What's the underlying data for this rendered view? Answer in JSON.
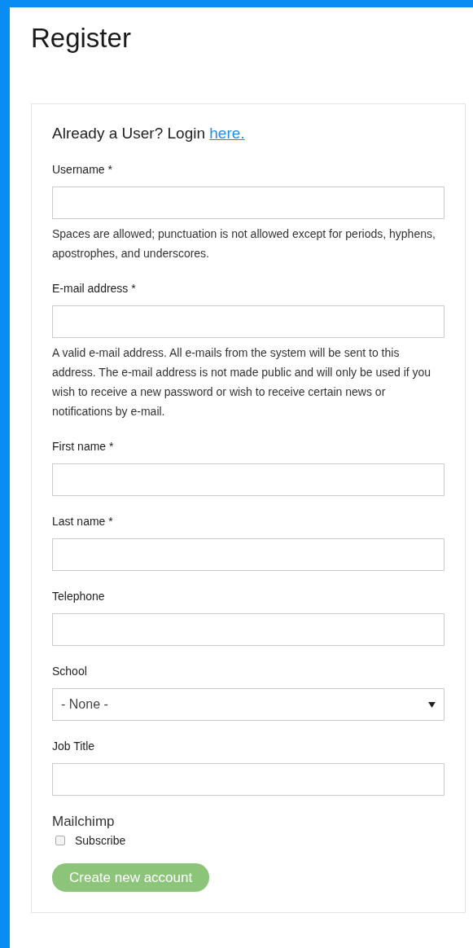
{
  "page": {
    "title": "Register"
  },
  "login_prompt": {
    "text": "Already a User? Login",
    "link": "here."
  },
  "fields": [
    {
      "kind": "text",
      "label": "Username *",
      "help": "Spaces are allowed; punctuation is not allowed except for periods, hyphens, apostrophes, and underscores."
    },
    {
      "kind": "text",
      "label": "E-mail address *",
      "help": "A valid e-mail address. All e-mails from the system will be sent to this address. The e-mail address is not made public and will only be used if you wish to receive a new password or wish to receive certain news or notifications by e-mail."
    },
    {
      "kind": "text",
      "label": "First name *"
    },
    {
      "kind": "text",
      "label": "Last name *"
    },
    {
      "kind": "text",
      "label": "Telephone"
    },
    {
      "kind": "select",
      "label": "School",
      "value": "- None -"
    },
    {
      "kind": "text",
      "label": "Job Title"
    }
  ],
  "mailchimp": {
    "heading": "Mailchimp",
    "subscribe": {
      "label": "Subscribe",
      "checked": false
    }
  },
  "submit": {
    "label": "Create new account"
  }
}
